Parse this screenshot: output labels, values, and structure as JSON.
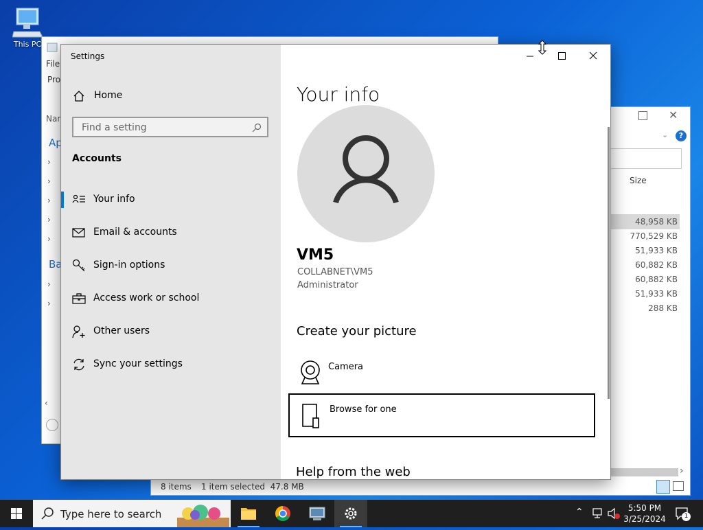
{
  "desktop": {
    "icon_label": "This PC"
  },
  "explorer_left": {
    "title": "File",
    "menu_file": "File",
    "row_label": "Pro",
    "col_label": "Nam",
    "side_labels": [
      "Ap",
      "Ba"
    ]
  },
  "explorer_right": {
    "size_header": "Size",
    "sizes": [
      "48,958 KB",
      "770,529 KB",
      "51,933 KB",
      "60,882 KB",
      "60,882 KB",
      "51,933 KB",
      "288 KB"
    ],
    "status_items": "8 items",
    "status_selected": "1 item selected  47.8 MB"
  },
  "settings": {
    "window_title": "Settings",
    "home_label": "Home",
    "search_placeholder": "Find a setting",
    "section_title": "Accounts",
    "nav": [
      {
        "label": "Your info",
        "icon": "person-card-icon",
        "active": true
      },
      {
        "label": "Email & accounts",
        "icon": "mail-icon",
        "active": false
      },
      {
        "label": "Sign-in options",
        "icon": "key-icon",
        "active": false
      },
      {
        "label": "Access work or school",
        "icon": "briefcase-icon",
        "active": false
      },
      {
        "label": "Other users",
        "icon": "person-add-icon",
        "active": false
      },
      {
        "label": "Sync your settings",
        "icon": "sync-icon",
        "active": false
      }
    ],
    "page_title": "Your info",
    "user_name": "VM5",
    "user_domain": "COLLABNET\\VM5",
    "user_role": "Administrator",
    "create_picture_title": "Create your picture",
    "camera_label": "Camera",
    "browse_label": "Browse for one",
    "help_title": "Help from the web"
  },
  "taskbar": {
    "search_placeholder": "Type here to search",
    "time": "5:50 PM",
    "date": "3/25/2024",
    "notification_count": "1"
  },
  "colors": {
    "accent": "#0078d7",
    "nav_background": "#e6e6e6",
    "taskbar": "#1f1f1f",
    "desktop": "#0b62d6"
  }
}
